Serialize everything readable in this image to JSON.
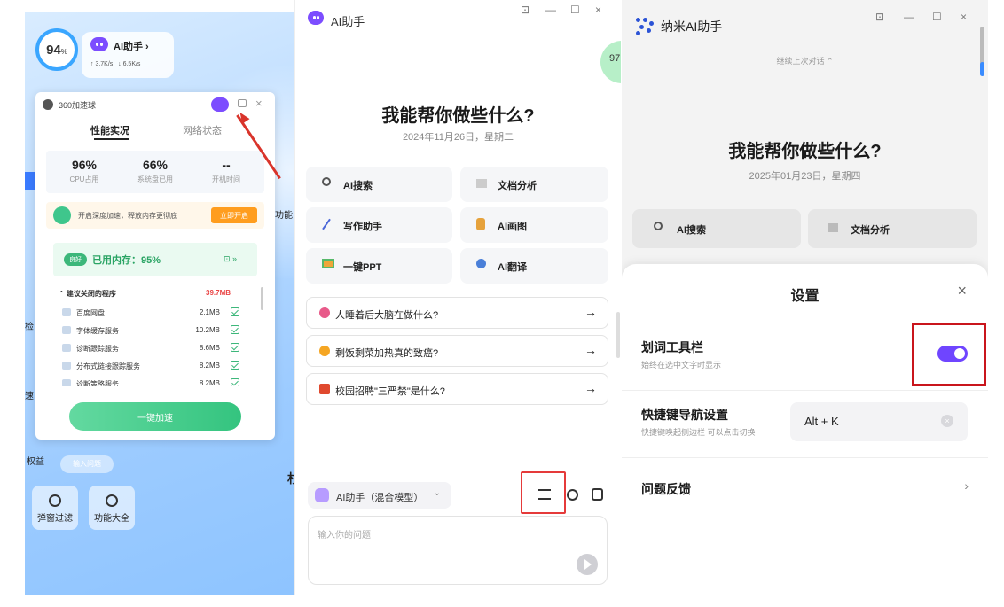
{
  "panel360": {
    "score": "94",
    "score_unit": "%",
    "ai_label": "AI助手 ›",
    "upload": "↑ 3.7K/s",
    "download": "↓ 6.5K/s",
    "brand": "360加速球",
    "tab_perf": "性能实况",
    "tab_net": "网络状态",
    "stats": [
      {
        "value": "96%",
        "label": "CPU占用"
      },
      {
        "value": "66%",
        "label": "系统盘已用"
      },
      {
        "value": "--",
        "label": "开机时间"
      }
    ],
    "banner_text": "开启深度加速，释放内存更彻底",
    "banner_button": "立即开启",
    "mem_tag": "良好",
    "mem_text": "已用内存：95%",
    "mem_more": "⊡ »",
    "list_header": "⌃ 建议关闭的程序",
    "list_total": "39.7MB",
    "programs": [
      {
        "name": "百度网盘",
        "size": "2.1MB"
      },
      {
        "name": "字体缓存服务",
        "size": "10.2MB"
      },
      {
        "name": "诊断跟踪服务",
        "size": "8.6MB"
      },
      {
        "name": "分布式链接跟踪服务",
        "size": "8.2MB"
      },
      {
        "name": "诊断策略服务",
        "size": "8.2MB"
      }
    ],
    "accel_button": "一键加速",
    "side_texts": [
      "功能",
      "检",
      "速",
      "权益",
      "输入问题",
      "杉"
    ],
    "bottom_buttons": [
      "弹窗过滤",
      "功能大全"
    ]
  },
  "panel_ai": {
    "title": "AI助手",
    "window_controls": [
      "⊡",
      "—",
      "☐",
      "×"
    ],
    "bubble": "97",
    "headline": "我能帮你做些什么?",
    "date": "2024年11月26日，星期二",
    "quick": [
      {
        "label": "AI搜索",
        "icon": "search-icon"
      },
      {
        "label": "文档分析",
        "icon": "document-icon"
      },
      {
        "label": "写作助手",
        "icon": "pen-icon"
      },
      {
        "label": "AI画图",
        "icon": "paint-icon"
      },
      {
        "label": "一键PPT",
        "icon": "ppt-icon"
      },
      {
        "label": "AI翻译",
        "icon": "translate-icon"
      }
    ],
    "suggestions": [
      {
        "text": "人睡着后大脑在做什么?",
        "color": "#e85a8a"
      },
      {
        "text": "剩饭剩菜加热真的致癌?",
        "color": "#f5a623"
      },
      {
        "text": "校园招聘\"三严禁\"是什么?",
        "color": "#e0492e"
      }
    ],
    "model_label": "AI助手（混合模型）",
    "input_placeholder": "输入你的问题"
  },
  "panel_nm": {
    "title": "纳米AI助手",
    "window_controls": [
      "⊡",
      "—",
      "☐",
      "×"
    ],
    "continue_text": "继续上次对话 ⌃",
    "headline": "我能帮你做些什么?",
    "date": "2025年01月23日，星期四",
    "quick": [
      "AI搜索",
      "文档分析"
    ],
    "settings": {
      "title": "设置",
      "close": "×",
      "toolbar_title": "划词工具栏",
      "toolbar_sub": "始终在选中文字时显示",
      "toolbar_enabled": true,
      "hotkey_title": "快捷键导航设置",
      "hotkey_sub": "快捷键唤起侧边栏 可以点击切换",
      "hotkey_value": "Alt + K",
      "hotkey_clear": "×",
      "feedback": "问题反馈",
      "feedback_chev": "›"
    }
  },
  "colors": {
    "accent_purple": "#6f45ff",
    "highlight_red": "#c9151c",
    "green": "#34c47f",
    "orange": "#ff9d1e"
  }
}
